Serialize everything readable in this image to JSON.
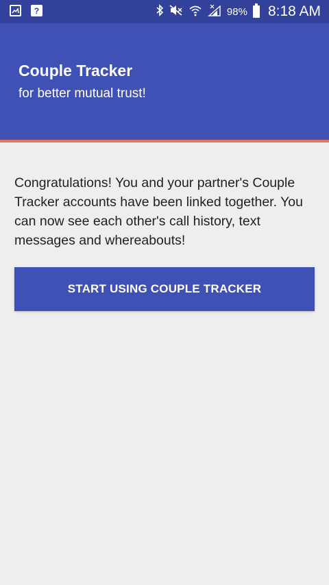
{
  "status_bar": {
    "left_icons": [
      "gallery-notification-icon",
      "help-notification-icon"
    ],
    "help_glyph": "?",
    "right_icons": [
      "bluetooth-icon",
      "mute-icon",
      "wifi-icon",
      "signal-icon"
    ],
    "battery_percent": "98%",
    "time": "8:18 AM"
  },
  "header": {
    "title": "Couple Tracker",
    "subtitle": "for better mutual trust!"
  },
  "main": {
    "message": "Congratulations! You and your partner's Couple Tracker accounts have been linked together. You can now see each other's call history, text messages and whereabouts!",
    "button_label": "START USING COUPLE TRACKER"
  },
  "colors": {
    "status_bar": "#324199",
    "primary": "#3f51b5",
    "accent_line": "#e2765a",
    "background": "#eeeeee"
  }
}
